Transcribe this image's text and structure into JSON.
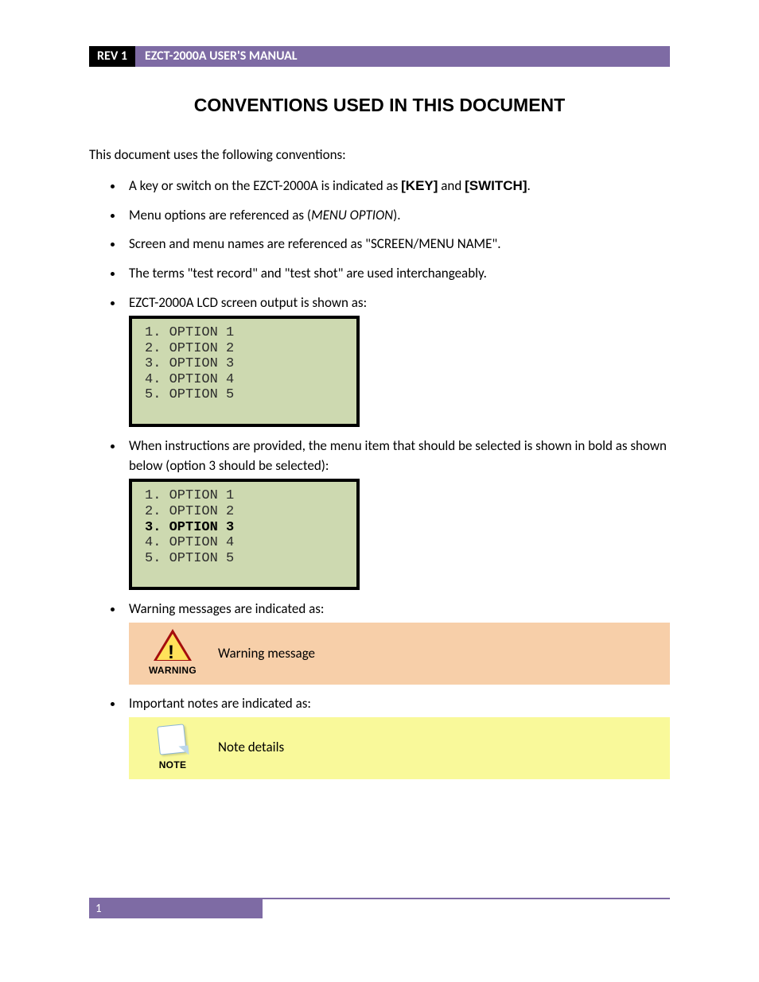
{
  "header": {
    "rev": "REV 1",
    "title": "EZCT-2000A USER'S MANUAL"
  },
  "section_title": "CONVENTIONS USED IN THIS DOCUMENT",
  "intro": "This document uses the following conventions:",
  "bullets": {
    "b1_pre": "A key or switch on the EZCT-2000A is indicated as ",
    "b1_key": "[KEY]",
    "b1_and": " and ",
    "b1_switch": "[SWITCH]",
    "b1_post": ".",
    "b2_pre": "Menu options are referenced as (",
    "b2_opt": "MENU OPTION",
    "b2_post": ").",
    "b3": "Screen and menu names are referenced as \"SCREEN/MENU NAME\".",
    "b4": "The terms \"test record\" and \"test shot\" are used interchangeably.",
    "b5": "EZCT-2000A LCD screen output is shown as:",
    "b6": "When instructions are provided, the menu item that should be selected is shown in bold as shown below (option 3 should be selected):",
    "b7": "Warning messages are indicated as:",
    "b8": "Important notes are indicated as:"
  },
  "lcd1": {
    "o1": "1. OPTION 1",
    "o2": "2. OPTION 2",
    "o3": "3. OPTION 3",
    "o4": "4. OPTION 4",
    "o5": "5. OPTION 5"
  },
  "lcd2": {
    "o1": "1. OPTION 1",
    "o2": "2. OPTION 2",
    "o3": "3. OPTION 3",
    "o4": "4. OPTION 4",
    "o5": "5. OPTION 5",
    "bold_index": 3
  },
  "warning": {
    "label": "WARNING",
    "msg": "Warning message"
  },
  "note": {
    "label": "NOTE",
    "msg": "Note details"
  },
  "page_number": "1"
}
